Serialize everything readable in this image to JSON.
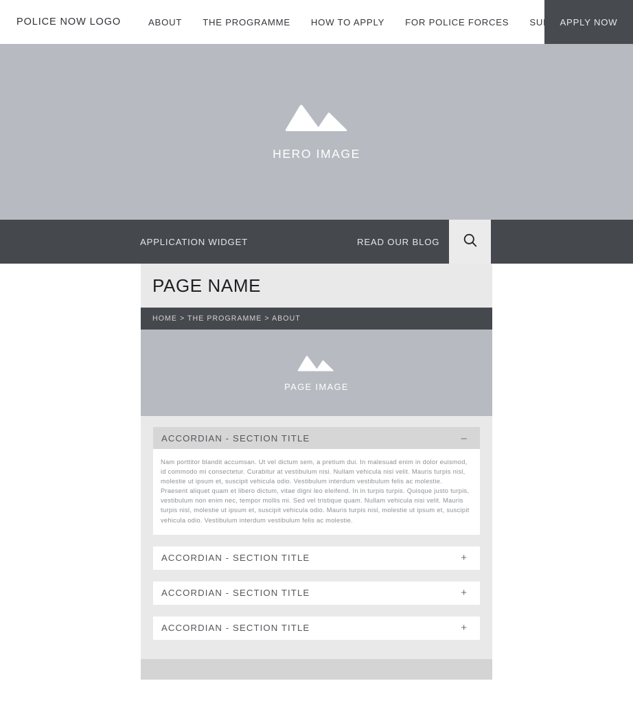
{
  "topnav": {
    "logo": "POLICE NOW LOGO",
    "links": [
      {
        "label": "ABOUT"
      },
      {
        "label": "THE PROGRAMME"
      },
      {
        "label": "HOW TO APPLY"
      },
      {
        "label": "FOR POLICE FORCES"
      },
      {
        "label": "SUPPORT US"
      }
    ],
    "cta": "APPLY NOW"
  },
  "hero": {
    "label": "HERO IMAGE",
    "icon": "image-placeholder-icon"
  },
  "subnav": {
    "application_widget": "APPLICATION WIDGET",
    "read_our_blog": "READ OUR BLOG",
    "search_icon": "search-icon"
  },
  "page": {
    "title": "PAGE NAME",
    "breadcrumb": "HOME > THE PROGRAMME > ABOUT",
    "page_image_label": "PAGE IMAGE"
  },
  "accordion": {
    "items": [
      {
        "title": "ACCORDIAN - SECTION TITLE",
        "sign": "–",
        "state": "open",
        "body": "Nam porttitor blandit accumsan. Ut vel dictum sem, a pretium dui. In malesuad enim in dolor euismod, id commodo mi consectetur. Curabitur at vestibulum nisi. Nullam vehicula nisi velit. Mauris turpis nisl, molestie ut ipsum et, suscipit vehicula odio. Vestibulum interdum vestibulum felis ac molestie. Praesent aliquet quam et libero dictum, vitae digni leo eleifend. In in turpis turpis. Quisque justo turpis, vestibulum non enim nec, tempor mollis mi. Sed vel tristique quam. Nullam vehicula nisi velit. Mauris turpis nisl, molestie ut ipsum et, suscipit vehicula odio. Mauris turpis nisl, molestie ut ipsum et, suscipit vehicula odio. Vestibulum interdum vestibulum felis ac molestie."
      },
      {
        "title": "ACCORDIAN - SECTION TITLE",
        "sign": "+",
        "state": "closed",
        "body": ""
      },
      {
        "title": "ACCORDIAN - SECTION TITLE",
        "sign": "+",
        "state": "closed",
        "body": ""
      },
      {
        "title": "ACCORDIAN - SECTION TITLE",
        "sign": "+",
        "state": "closed",
        "body": ""
      }
    ]
  },
  "colors": {
    "dark": "#45484d",
    "placeholder_gray": "#b7bbc1",
    "body_bg": "#e9e9e9",
    "footer_strip": "#d4d4d4",
    "accordion_open_header": "#d6d6d6",
    "text_muted": "#8d9095"
  }
}
